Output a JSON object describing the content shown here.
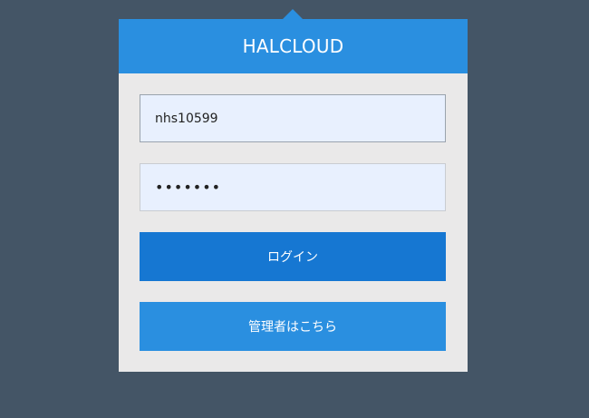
{
  "app": {
    "title": "HALCLOUD"
  },
  "form": {
    "username_value": "nhs10599",
    "password_value": "•••••••",
    "login_label": "ログイン",
    "admin_label": "管理者はこちら"
  },
  "colors": {
    "background": "#445566",
    "header": "#2a8fe0",
    "card": "#eae9e9",
    "login_button": "#1677d2",
    "admin_button": "#2a8fe0",
    "input_fill": "#e8f0fe"
  }
}
